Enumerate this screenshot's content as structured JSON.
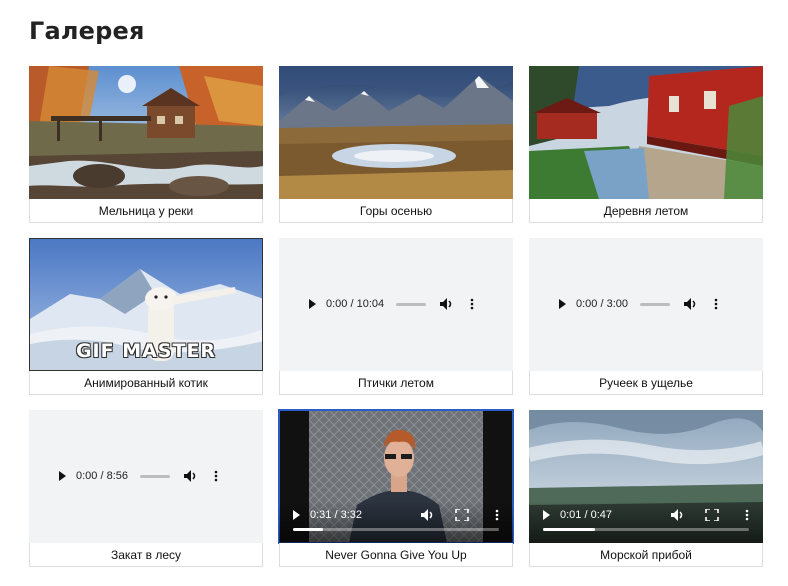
{
  "page": {
    "title": "Галерея"
  },
  "gallery": {
    "items": [
      {
        "kind": "image",
        "scene": "mill",
        "caption": "Мельница у реки"
      },
      {
        "kind": "image",
        "scene": "mountains",
        "caption": "Горы осенью"
      },
      {
        "kind": "image",
        "scene": "village",
        "caption": "Деревня летом"
      },
      {
        "kind": "image",
        "scene": "cat-gif",
        "caption": "Анимированный котик",
        "overlay_text": "GIF MASTER"
      },
      {
        "kind": "audio",
        "caption": "Птички летом",
        "time": "0:00 / 10:04"
      },
      {
        "kind": "audio",
        "caption": "Ручеек в ущелье",
        "time": "0:00 / 3:00"
      },
      {
        "kind": "audio",
        "caption": "Закат в лесу",
        "time": "0:00 / 8:56"
      },
      {
        "kind": "video",
        "scene": "singer",
        "caption": "Never Gonna Give You Up",
        "time": "0:31 / 3:32",
        "progress": 0.146
      },
      {
        "kind": "video",
        "scene": "sea",
        "caption": "Морской прибой",
        "time": "0:01 / 0:47",
        "progress": 0.25
      }
    ]
  },
  "colors": {
    "focus": "#2c5cc5",
    "caption_border": "#dddddd",
    "audio_bg": "#f1f3f4"
  }
}
